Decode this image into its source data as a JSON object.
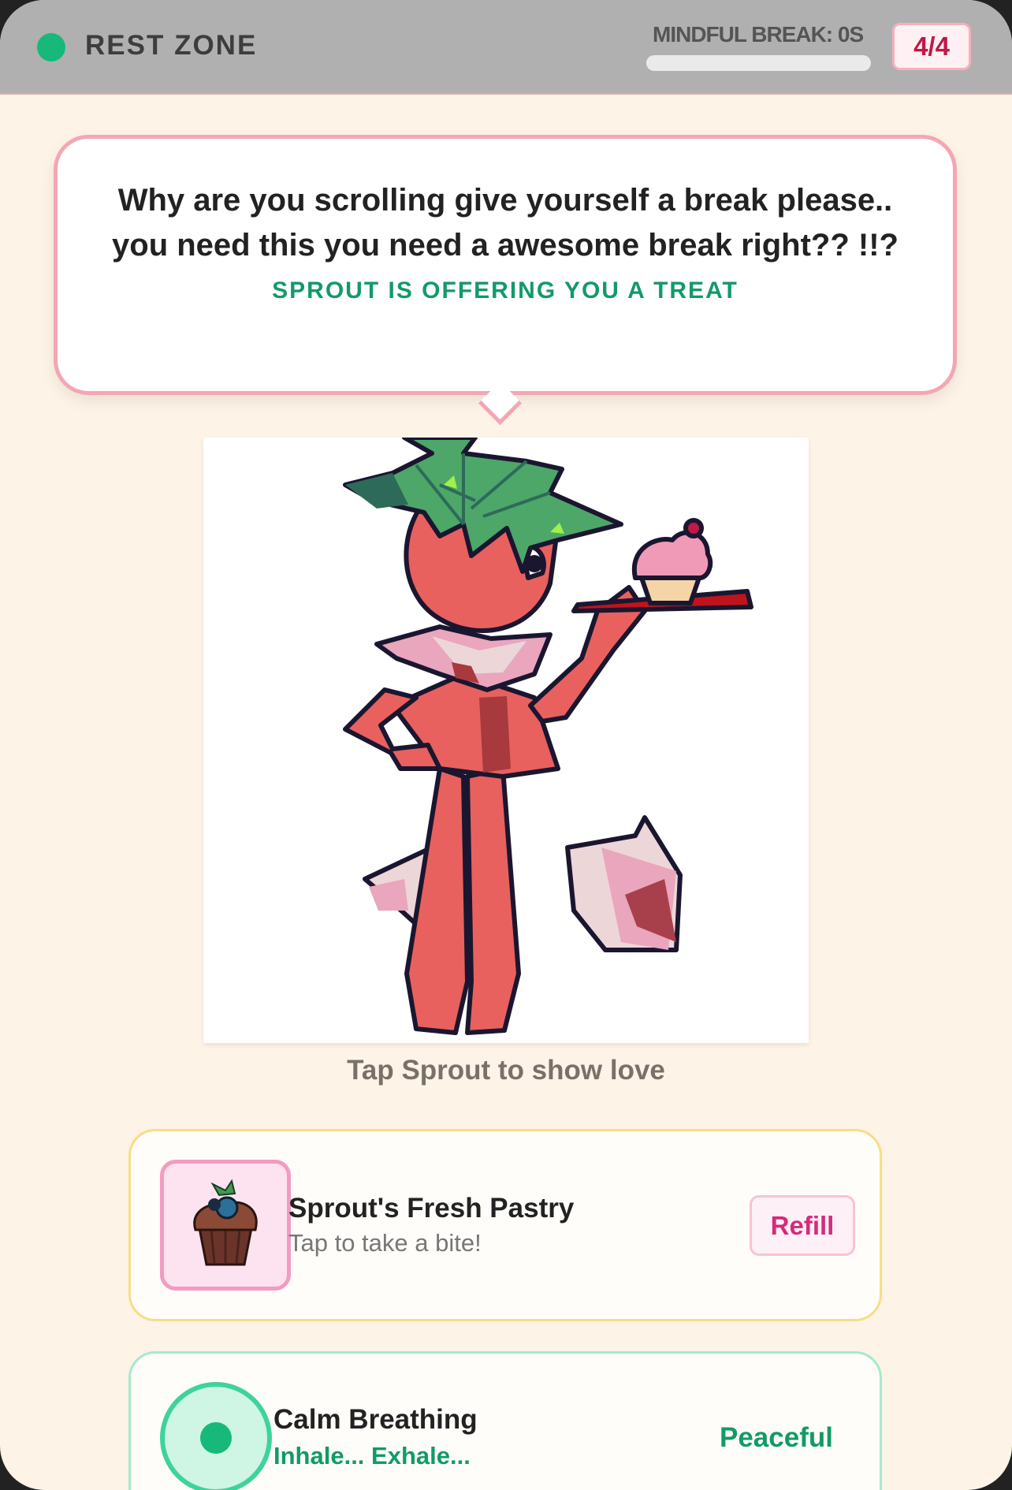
{
  "header": {
    "title": "REST ZONE",
    "break_label": "MINDFUL BREAK: 0S",
    "break_progress": 0,
    "count": "4/4"
  },
  "bubble": {
    "message": "Why are you scrolling give yourself a break please.. you need this you need a awesome break right?? !!?",
    "subtitle": "SPROUT IS OFFERING YOU A TREAT"
  },
  "mascot": {
    "name": "Sprout",
    "hint": "Tap Sprout to show love"
  },
  "pastry": {
    "title": "Sprout's Fresh Pastry",
    "subtitle": "Tap to take a bite!",
    "button_label": "Refill"
  },
  "breathing": {
    "title": "Calm Breathing",
    "subtitle": "Inhale... Exhale...",
    "state": "Peaceful"
  },
  "colors": {
    "accent_green": "#16b97a",
    "accent_pink": "#f4a6b4",
    "background": "#fdf3e6"
  }
}
